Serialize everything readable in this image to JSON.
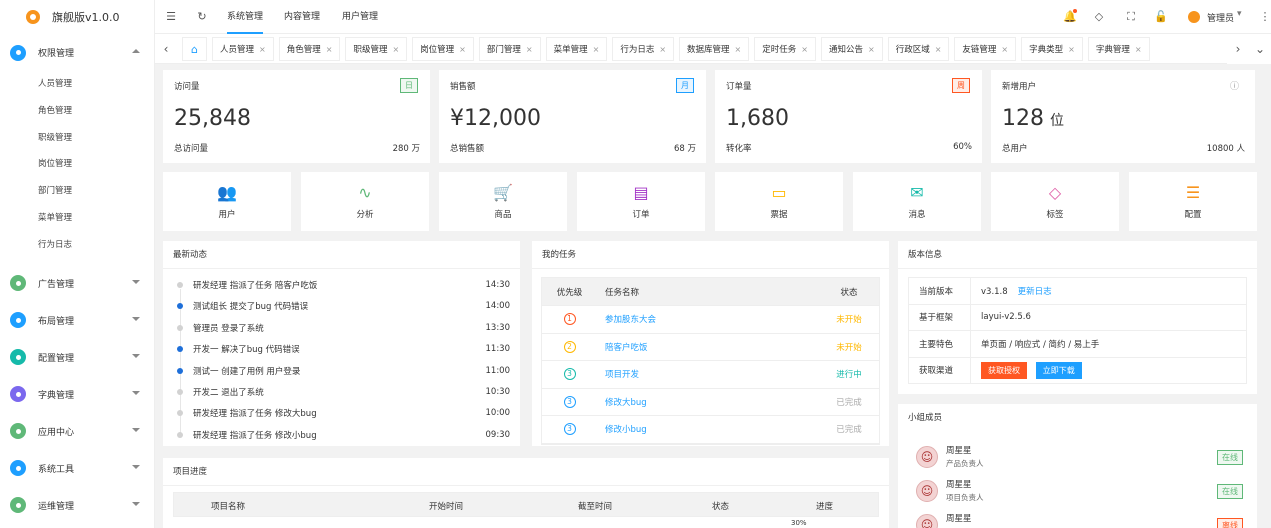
{
  "app": {
    "title": "旗舰版v1.0.0"
  },
  "colors": {
    "accent": "#1e9fff",
    "green": "#16baaa",
    "orange": "#ffb800",
    "red": "#ff5722",
    "warm": "#f7941d"
  },
  "sidebar": {
    "groups": [
      {
        "label": "权限管理",
        "color": "#1e9fff",
        "expanded": true,
        "items": [
          "人员管理",
          "角色管理",
          "职级管理",
          "岗位管理",
          "部门管理",
          "菜单管理",
          "行为日志"
        ]
      },
      {
        "label": "广告管理",
        "color": "#5fb878"
      },
      {
        "label": "布局管理",
        "color": "#1e9fff"
      },
      {
        "label": "配置管理",
        "color": "#16baaa"
      },
      {
        "label": "字典管理",
        "color": "#7b68ee"
      },
      {
        "label": "应用中心",
        "color": "#5fb878"
      },
      {
        "label": "系统工具",
        "color": "#1e9fff"
      },
      {
        "label": "运维管理",
        "color": "#5fb878"
      }
    ]
  },
  "topbar": {
    "tabs": [
      "系统管理",
      "内容管理",
      "用户管理"
    ],
    "user": "管理员"
  },
  "pagetabs": [
    {
      "label": "人员管理"
    },
    {
      "label": "角色管理"
    },
    {
      "label": "职级管理"
    },
    {
      "label": "岗位管理"
    },
    {
      "label": "部门管理"
    },
    {
      "label": "菜单管理"
    },
    {
      "label": "行为日志"
    },
    {
      "label": "数据库管理"
    },
    {
      "label": "定时任务"
    },
    {
      "label": "通知公告"
    },
    {
      "label": "行政区域"
    },
    {
      "label": "友链管理"
    },
    {
      "label": "字典类型"
    },
    {
      "label": "字典管理"
    }
  ],
  "stats": [
    {
      "title": "访问量",
      "badge": "日",
      "value": "25,848",
      "unit": "",
      "foot_label": "总访问量",
      "foot_value": "280 万"
    },
    {
      "title": "销售额",
      "badge": "月",
      "value": "¥12,000",
      "unit": "",
      "foot_label": "总销售额",
      "foot_value": "68 万"
    },
    {
      "title": "订单量",
      "badge": "周",
      "value": "1,680",
      "unit": "",
      "foot_label": "转化率",
      "foot_value": "60%"
    },
    {
      "title": "新增用户",
      "badge": "ⓘ",
      "value": "128",
      "unit": "位",
      "foot_label": "总用户",
      "foot_value": "10800 人"
    }
  ],
  "quick": [
    {
      "label": "用户",
      "icon": "users-icon",
      "glyph": "👥",
      "color": "#1e9fff"
    },
    {
      "label": "分析",
      "icon": "pulse-icon",
      "glyph": "∿",
      "color": "#5fb878"
    },
    {
      "label": "商品",
      "icon": "cart-icon",
      "glyph": "🛒",
      "color": "#ff5722"
    },
    {
      "label": "订单",
      "icon": "clipboard-icon",
      "glyph": "▤",
      "color": "#a233c6"
    },
    {
      "label": "票据",
      "icon": "card-icon",
      "glyph": "▭",
      "color": "#ffb800"
    },
    {
      "label": "消息",
      "icon": "mail-icon",
      "glyph": "✉",
      "color": "#16baaa"
    },
    {
      "label": "标签",
      "icon": "tag-icon",
      "glyph": "◇",
      "color": "#e060a8"
    },
    {
      "label": "配置",
      "icon": "sliders-icon",
      "glyph": "☰",
      "color": "#f7941d"
    }
  ],
  "activity": {
    "title": "最新动态",
    "items": [
      {
        "text": "研发经理 指派了任务 陪客户吃饭",
        "time": "14:30",
        "dot": "#d2d2d2"
      },
      {
        "text": "测试组长 提交了bug 代码错误",
        "time": "14:00",
        "dot": "#1e6fd9"
      },
      {
        "text": "管理员 登录了系统",
        "time": "13:30",
        "dot": "#d2d2d2"
      },
      {
        "text": "开发一 解决了bug 代码错误",
        "time": "11:30",
        "dot": "#1e6fd9"
      },
      {
        "text": "测试一 创建了用例 用户登录",
        "time": "11:00",
        "dot": "#1e6fd9"
      },
      {
        "text": "开发二 退出了系统",
        "time": "10:30",
        "dot": "#d2d2d2"
      },
      {
        "text": "研发经理 指派了任务 修改大bug",
        "time": "10:00",
        "dot": "#d2d2d2"
      },
      {
        "text": "研发经理 指派了任务 修改小bug",
        "time": "09:30",
        "dot": "#d2d2d2"
      }
    ]
  },
  "tasks": {
    "title": "我的任务",
    "headers": [
      "优先级",
      "任务名称",
      "状态"
    ],
    "rows": [
      {
        "prio": "1",
        "prio_color": "#ff5722",
        "name": "参加股东大会",
        "status": "未开始",
        "status_color": "#ffb800"
      },
      {
        "prio": "2",
        "prio_color": "#ffb800",
        "name": "陪客户吃饭",
        "status": "未开始",
        "status_color": "#ffb800"
      },
      {
        "prio": "3",
        "prio_color": "#16baaa",
        "name": "项目开发",
        "status": "进行中",
        "status_color": "#16baaa"
      },
      {
        "prio": "3",
        "prio_color": "#1e9fff",
        "name": "修改大bug",
        "status": "已完成",
        "status_color": "#aaaaaa"
      },
      {
        "prio": "3",
        "prio_color": "#1e9fff",
        "name": "修改小bug",
        "status": "已完成",
        "status_color": "#aaaaaa"
      }
    ]
  },
  "version": {
    "title": "版本信息",
    "rows": [
      {
        "label": "当前版本",
        "value": "v3.1.8",
        "link": "更新日志"
      },
      {
        "label": "基于框架",
        "value": "layui-v2.5.6",
        "link": ""
      },
      {
        "label": "主要特色",
        "value": "单页面 / 响应式 / 简约 / 易上手",
        "link": ""
      }
    ],
    "channel_label": "获取渠道",
    "btn_auth": "获取授权",
    "btn_download": "立即下载"
  },
  "team": {
    "title": "小组成员",
    "members": [
      {
        "name": "周星星",
        "role": "产品负责人",
        "status": "在线",
        "status_color": "#5fb878"
      },
      {
        "name": "周星星",
        "role": "项目负责人",
        "status": "在线",
        "status_color": "#5fb878"
      },
      {
        "name": "周星星",
        "role": "",
        "status": "离线",
        "status_color": "#ff5722"
      }
    ]
  },
  "progress": {
    "title": "项目进度",
    "headers": [
      "项目名称",
      "开始时间",
      "截至时间",
      "状态",
      "进度"
    ],
    "first_row_progress": "30%"
  }
}
